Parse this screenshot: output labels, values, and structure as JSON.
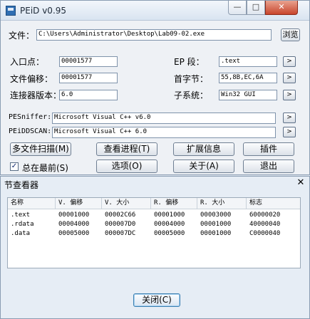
{
  "window": {
    "title": "PEiD v0.95",
    "controls": {
      "minimize": "—",
      "maximize": "□",
      "close": "✕"
    }
  },
  "file": {
    "label": "文件：",
    "path": "C:\\Users\\Administrator\\Desktop\\Lab09-02.exe",
    "browse_label": "浏览"
  },
  "fields": {
    "entry_point_label": "入口点：",
    "entry_point": "00001577",
    "ep_section_label": "EP 段：",
    "ep_section": ".text",
    "file_offset_label": "文件偏移：",
    "file_offset": "00001577",
    "first_bytes_label": "首字节：",
    "first_bytes": "55,8B,EC,6A",
    "linker_label": "连接器版本：",
    "linker": "6.0",
    "subsystem_label": "子系统：",
    "subsystem": "Win32 GUI"
  },
  "scan": {
    "pesniffer_label": "PESniffer:",
    "pesniffer": "Microsoft Visual C++ v6.0",
    "peiddscan_label": "PEiDDSCAN:",
    "peiddscan": "Microsoft Visual C++ 6.0"
  },
  "buttons": {
    "arrow": ">",
    "multi_scan": "多文件扫描(M)",
    "task_viewer": "查看进程(T)",
    "extra_info": "扩展信息",
    "plugins": "插件",
    "options": "选项(O)",
    "about": "关于(A)",
    "exit": "退出"
  },
  "always_on_top": {
    "label": "总在最前(S)",
    "checked": true,
    "mark": "✓"
  },
  "section_viewer": {
    "title": "节查看器",
    "close_x": "✕",
    "columns": [
      "名称",
      "V. 偏移",
      "V. 大小",
      "R. 偏移",
      "R. 大小",
      "标志"
    ],
    "rows": [
      [
        ".text",
        "00001000",
        "00002C66",
        "00001000",
        "00003000",
        "60000020"
      ],
      [
        ".rdata",
        "00004000",
        "000007D0",
        "00004000",
        "00001000",
        "40000040"
      ],
      [
        ".data",
        "00005000",
        "000007DC",
        "00005000",
        "00001000",
        "C0000040"
      ]
    ],
    "close_button": "关闭(C)"
  }
}
